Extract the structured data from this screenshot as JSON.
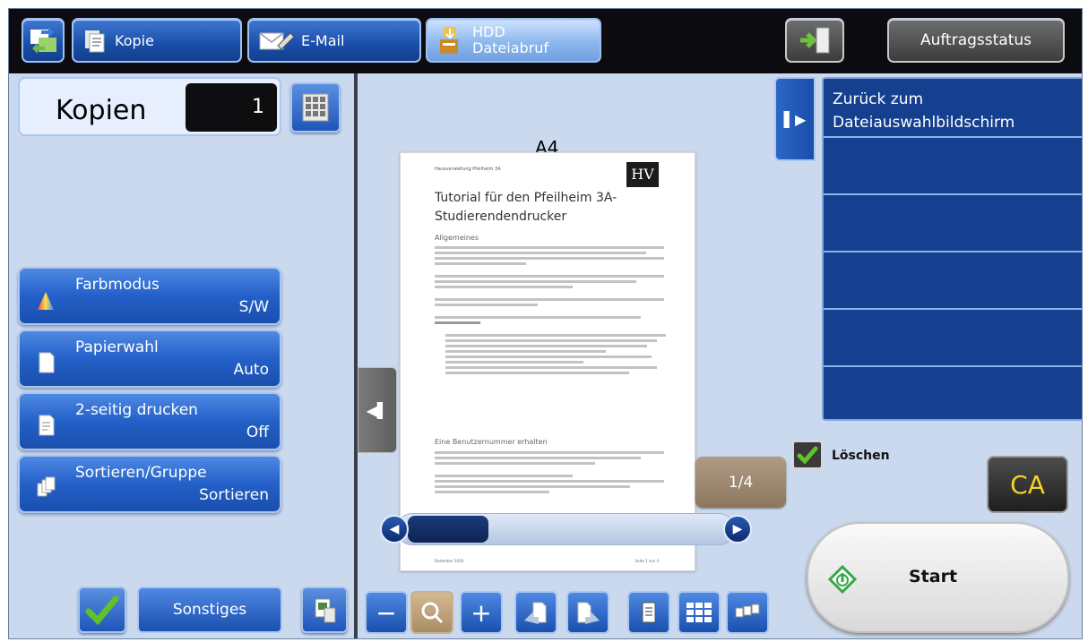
{
  "tabs": {
    "kopie": "Kopie",
    "email": "E-Mail",
    "hdd_line1": "HDD",
    "hdd_line2": "Dateiabruf",
    "auftragsstatus": "Auftragsstatus"
  },
  "kopien": {
    "label": "Kopien",
    "value": "1"
  },
  "functions": [
    {
      "title": "Farbmodus",
      "value": "S/W"
    },
    {
      "title": "Papierwahl",
      "value": "Auto"
    },
    {
      "title": "2-seitig drucken",
      "value": "Off"
    },
    {
      "title": "Sortieren/Gruppe",
      "value": "Sortieren"
    }
  ],
  "bottom": {
    "sonstiges": "Sonstiges"
  },
  "preview": {
    "paper_size": "A4",
    "page_counter": "1/4"
  },
  "document": {
    "header": "Hausverwaltung Pfeilheim 3A",
    "logo": "HV",
    "title": "Tutorial für den Pfeilheim 3A-Studierendendrucker",
    "section1": "Allgemeines",
    "section2": "Eine Benutzernummer erhalten",
    "footer_left": "Dezember 2016",
    "footer_right": "Seite 1 von 4"
  },
  "file_list": {
    "items": [
      "Zurück zum Dateiauswahlbildschirm",
      "",
      "",
      "",
      "",
      ""
    ]
  },
  "actions": {
    "loeschen": "Löschen",
    "ca": "CA",
    "start": "Start"
  }
}
